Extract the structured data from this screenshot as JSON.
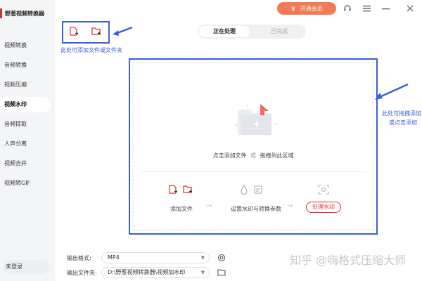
{
  "app": {
    "title": "野葱视频转换器",
    "brand_color": "#d6332b",
    "accent": "#3b5fd8"
  },
  "sidebar": {
    "items": [
      {
        "label": "视频转换",
        "active": false
      },
      {
        "label": "音频转换",
        "active": false
      },
      {
        "label": "视频压缩",
        "active": false
      },
      {
        "label": "视频水印",
        "active": true
      },
      {
        "label": "音频提取",
        "active": false
      },
      {
        "label": "人声分离",
        "active": false
      },
      {
        "label": "视频合并",
        "active": false
      },
      {
        "label": "视频转GIF",
        "active": false
      }
    ],
    "login_label": "未登录"
  },
  "titlebar": {
    "vip_label": "开通会员",
    "icons": [
      "headset-icon",
      "menu-icon",
      "minimize-icon",
      "close-icon"
    ]
  },
  "quick_add": {
    "hint": "此处可添加文件或文件夹",
    "icons": [
      "add-file-icon",
      "add-folder-icon"
    ]
  },
  "tabs": {
    "processing": "正在处理",
    "done": "已完成"
  },
  "drop_area": {
    "text_left": "点击添加文件",
    "text_or": "或",
    "text_right": "拖拽到此区域",
    "hint_line1": "此处可拖拽添加",
    "hint_line2": "或点击添加"
  },
  "steps": {
    "step1": "添加文件",
    "step2": "设置水印与转换参数",
    "step3": "处理水印"
  },
  "output": {
    "format_label": "输出格式:",
    "format_value": "MP4",
    "folder_label": "输出文件夹:",
    "folder_value": "D:\\野葱视频转换器\\视频加水印"
  },
  "watermark_text": "知乎 @嗨格式压缩大师"
}
